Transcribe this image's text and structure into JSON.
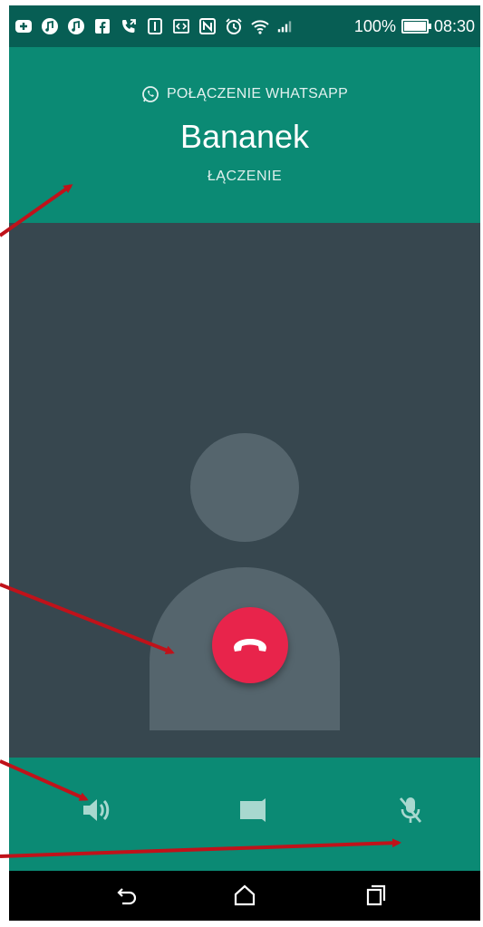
{
  "status_bar": {
    "icons": [
      "add-box-icon",
      "music-note-icon",
      "music-note-icon",
      "facebook-icon",
      "call-forward-icon",
      "tablet-icon",
      "code-icon",
      "nfc-icon",
      "alarm-icon",
      "wifi-icon",
      "signal-icon"
    ],
    "battery": "100%",
    "time": "08:30"
  },
  "call": {
    "type_label": "POŁĄCZENIE WHATSAPP",
    "contact_name": "Bananek",
    "status": "ŁĄCZENIE"
  },
  "controls": {
    "speaker": "speaker-icon",
    "video": "video-icon",
    "mute": "mic-off-icon",
    "end_call": "end-call-icon"
  },
  "colors": {
    "header": "#0b8a74",
    "status_bar": "#075e54",
    "body": "#37474f",
    "end_call": "#e8244b",
    "annotation": "#c0121a"
  }
}
